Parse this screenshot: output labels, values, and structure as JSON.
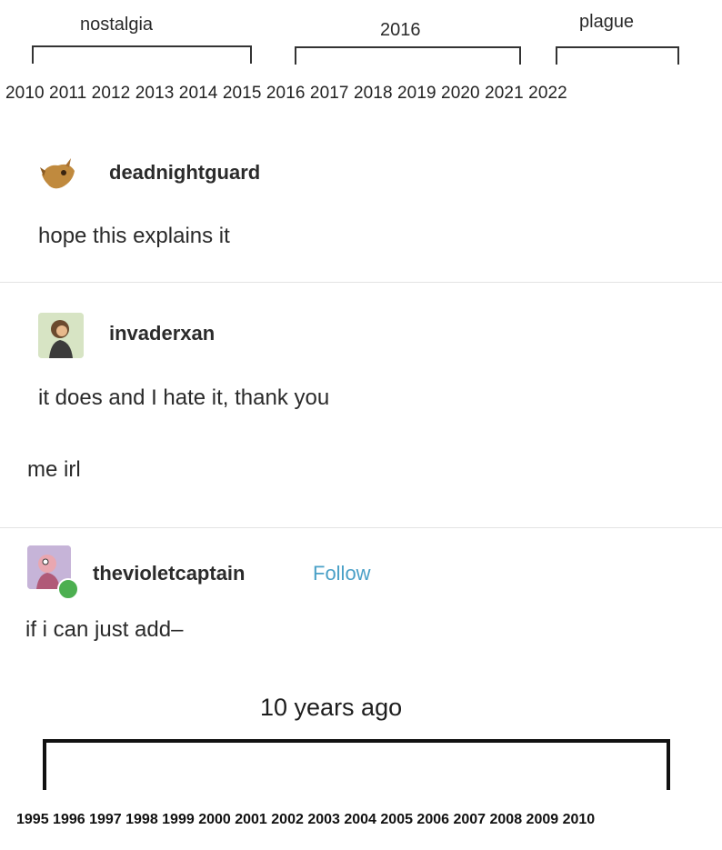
{
  "top_timeline": {
    "labels": {
      "nostalgia": "nostalgia",
      "year2016": "2016",
      "plague": "plague"
    },
    "years": "2010 2011 2012 2013 2014 2015 2016 2017 2018 2019 2020 2021 2022"
  },
  "posts": [
    {
      "username": "deadnightguard",
      "text": "hope this explains it"
    },
    {
      "username": "invaderxan",
      "text": "it does and I hate it, thank you",
      "caption": "me irl"
    },
    {
      "username": "thevioletcaptain",
      "follow_label": "Follow",
      "text": "if i can just add–"
    }
  ],
  "bottom_timeline": {
    "label": "10 years ago",
    "years": "1995 1996 1997 1998 1999 2000 2001 2002 2003 2004 2005 2006 2007 2008 2009 2010"
  },
  "colors": {
    "follow": "#4aa0c7",
    "divider": "#e3e3e3",
    "badge": "#4caf50"
  }
}
